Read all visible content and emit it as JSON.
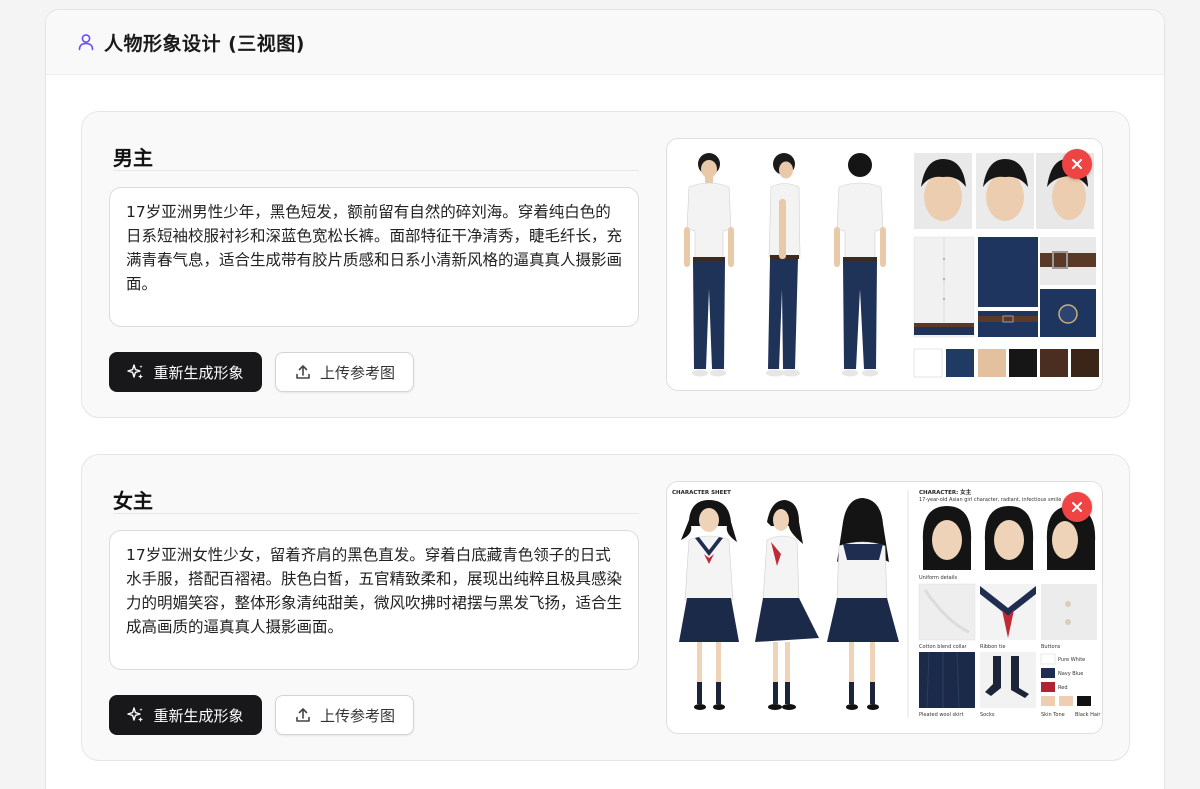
{
  "panel": {
    "title": "人物形象设计 (三视图)",
    "icon": "user-icon",
    "accent_color": "#6d4aff"
  },
  "characters": [
    {
      "role": "男主",
      "description": "17岁亚洲男性少年，黑色短发，额前留有自然的碎刘海。穿着纯白色的日系短袖校服衬衫和深蓝色宽松长裤。面部特征干净清秀，睫毛纤长，充满青春气息，适合生成带有胶片质感和日系小清新风格的逼真真人摄影画面。",
      "regenerate_label": "重新生成形象",
      "upload_label": "上传参考图",
      "palette": [
        "#ffffff",
        "#1f3a63",
        "#e3c09e",
        "#161616",
        "#4a2e22",
        "#3b2418"
      ]
    },
    {
      "role": "女主",
      "description": "17岁亚洲女性少女，留着齐肩的黑色直发。穿着白底藏青色领子的日式水手服，搭配百褶裙。肤色白皙，五官精致柔和，展现出纯粹且极具感染力的明媚笑容，整体形象清纯甜美，微风吹拂时裙摆与黑发飞扬，适合生成高画质的逼真真人摄影画面。",
      "regenerate_label": "重新生成形象",
      "upload_label": "上传参考图",
      "sheet_text": {
        "heading": "CHARACTER SHEET",
        "character": "CHARACTER: 女主",
        "subtitle": "17-year-old Asian girl character, radiant, infectious smile",
        "uniform_details": "Uniform details",
        "cotton": "Cotton blend collar",
        "ribbon": "Ribbon tie",
        "buttons": "Buttons",
        "skirt": "Pleated wool skirt",
        "socks": "Socks",
        "pure_white": "Pure White",
        "navy": "Navy Blue",
        "red": "Red",
        "skin": "Skin Tone",
        "black_hair": "Black Hair"
      }
    }
  ]
}
